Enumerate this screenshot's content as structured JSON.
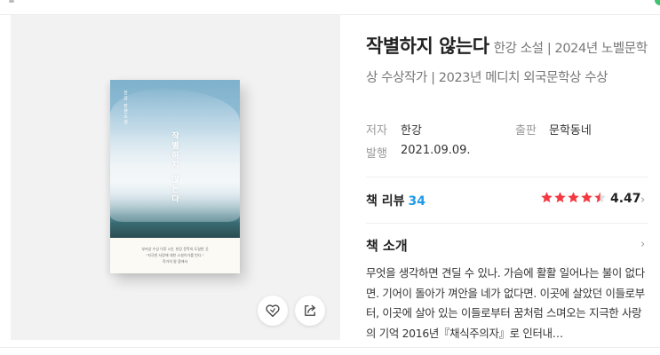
{
  "book": {
    "title": "작별하지 않는다",
    "subtitle": "한강 소설 | 2024년 노벨문학상 수상작가 | 2023년 메디치 외국문학상 수상",
    "author_label": "저자",
    "author": "한강",
    "publisher_label": "출판",
    "publisher": "문학동네",
    "issued_label": "발행",
    "issued": "2021.09.09."
  },
  "cover": {
    "author_vertical": "한강 장편소설",
    "title_vertical": "작별하지 않는다",
    "caption_line1": "부커상 수상 이후 5년, 한강 문학의 도달한 곳",
    "caption_line2": "\"지극한 사랑에 대한 소설이기를 빈다.\"",
    "caption_line3": "작가의 말 중에서"
  },
  "actions": {
    "like_icon": "heart-icon",
    "share_icon": "share-icon"
  },
  "reviews": {
    "label": "책 리뷰",
    "count": "34",
    "rating": "4.47",
    "rating_value": 4.47,
    "star_color": "#f5383f"
  },
  "intro": {
    "label": "책 소개",
    "text": "무엇을 생각하면 견딜 수 있나. 가슴에 활활 일어나는 불이 없다면. 기어이 돌아가 껴안을 네가 없다면. 이곳에 살았던 이들로부터, 이곳에 살아 있는 이들로부터 꿈처럼 스며오는 지극한 사랑의 기억 2016년『채식주의자』로 인터내…"
  },
  "colors": {
    "accent_blue": "#1e9be8",
    "star_red": "#f5383f"
  }
}
